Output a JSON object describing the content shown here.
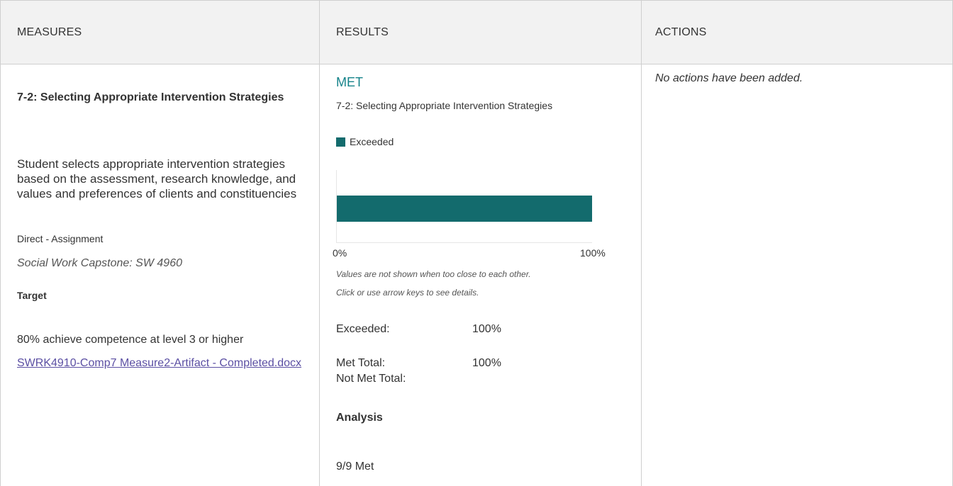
{
  "headers": {
    "measures": "MEASURES",
    "results": "RESULTS",
    "actions": "ACTIONS"
  },
  "measure": {
    "title": "7-2: Selecting Appropriate Intervention Strategies",
    "description": "Student selects appropriate intervention strategies based on the assessment, research knowledge, and values and preferences of clients and constituencies",
    "type": "Direct - Assignment",
    "course": "Social Work Capstone: SW 4960",
    "target_label": "Target",
    "target_text": "80% achieve competence at level 3 or higher",
    "link_text": "SWRK4910-Comp7 Measure2-Artifact - Completed.docx"
  },
  "result": {
    "status": "MET",
    "title": "7-2: Selecting Appropriate Intervention Strategies",
    "legend_label": "Exceeded",
    "note_line1": "Values are not shown when too close to each other.",
    "note_line2": "Click or use arrow keys to see details.",
    "exceeded_label": "Exceeded:",
    "exceeded_value": "100%",
    "met_total_label": "Met Total:",
    "met_total_value": "100%",
    "not_met_total_label": "Not Met Total:",
    "analysis_label": "Analysis",
    "analysis_text": "9/9 Met"
  },
  "actions": {
    "empty_text": "No actions have been added."
  },
  "colors": {
    "bar": "#136b6d",
    "status": "#16838a",
    "link": "#5b4fa3"
  },
  "chart_data": {
    "type": "bar",
    "orientation": "horizontal",
    "categories": [
      "7-2: Selecting Appropriate Intervention Strategies"
    ],
    "series": [
      {
        "name": "Exceeded",
        "values": [
          100
        ]
      }
    ],
    "xlim": [
      0,
      100
    ],
    "x_tick_labels": [
      "0%",
      "100%"
    ],
    "legend": "top-left"
  }
}
